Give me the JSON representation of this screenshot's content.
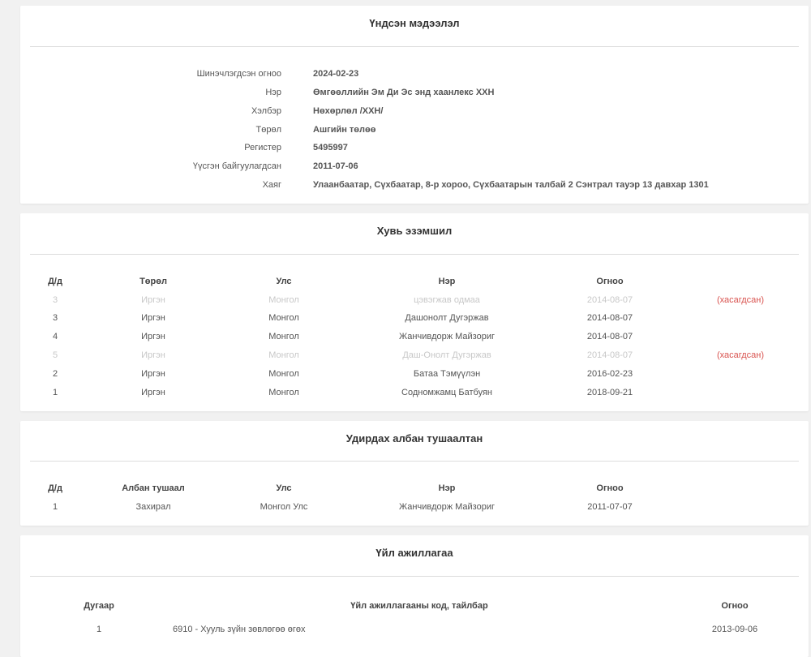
{
  "basic_info": {
    "title": "Үндсэн мэдээлэл",
    "rows": [
      {
        "label": "Шинэчлэгдсэн огноо",
        "value": "2024-02-23"
      },
      {
        "label": "Нэр",
        "value": "Өмгөөллийн Эм Ди Эс энд хаанлекс ХХН"
      },
      {
        "label": "Хэлбэр",
        "value": "Нөхөрлөл /ХХН/"
      },
      {
        "label": "Төрөл",
        "value": "Ашгийн төлөө"
      },
      {
        "label": "Регистер",
        "value": "5495997"
      },
      {
        "label": "Үүсгэн байгуулагдсан",
        "value": "2011-07-06"
      },
      {
        "label": "Хаяг",
        "value": "Улаанбаатар, Сүхбаатар, 8-р хороо, Сүхбаатарын талбай 2 Сэнтрал тауэр 13 давхар 1301"
      }
    ]
  },
  "ownership": {
    "title": "Хувь эзэмшил",
    "headers": [
      "Д/д",
      "Төрөл",
      "Улс",
      "Нэр",
      "Огноо"
    ],
    "rows": [
      {
        "no": "3",
        "type": "Иргэн",
        "country": "Монгол",
        "name": "цэвэгжав одмаа",
        "date": "2014-08-07",
        "status": "(хасагдсан)",
        "deleted": true
      },
      {
        "no": "3",
        "type": "Иргэн",
        "country": "Монгол",
        "name": "Дашонолт Дугэржав",
        "date": "2014-08-07",
        "status": "",
        "deleted": false
      },
      {
        "no": "4",
        "type": "Иргэн",
        "country": "Монгол",
        "name": "Жанчивдорж Майзориг",
        "date": "2014-08-07",
        "status": "",
        "deleted": false
      },
      {
        "no": "5",
        "type": "Иргэн",
        "country": "Монгол",
        "name": "Даш-Онолт Дугэржав",
        "date": "2014-08-07",
        "status": "(хасагдсан)",
        "deleted": true
      },
      {
        "no": "2",
        "type": "Иргэн",
        "country": "Монгол",
        "name": "Батаа Тэмүүлэн",
        "date": "2016-02-23",
        "status": "",
        "deleted": false
      },
      {
        "no": "1",
        "type": "Иргэн",
        "country": "Монгол",
        "name": "Содномжамц Батбуян",
        "date": "2018-09-21",
        "status": "",
        "deleted": false
      }
    ]
  },
  "officials": {
    "title": "Удирдах албан тушаалтан",
    "headers": [
      "Д/д",
      "Албан тушаал",
      "Улс",
      "Нэр",
      "Огноо"
    ],
    "rows": [
      {
        "no": "1",
        "position": "Захирал",
        "country": "Монгол Улс",
        "name": "Жанчивдорж Майзориг",
        "date": "2011-07-07"
      }
    ]
  },
  "activities": {
    "title": "Үйл ажиллагаа",
    "headers": [
      "Дугаар",
      "Үйл ажиллагааны код, тайлбар",
      "Огноо"
    ],
    "rows": [
      {
        "no": "1",
        "desc": "6910 - Хууль зүйн зөвлөгөө өгөх",
        "date": "2013-09-06"
      }
    ]
  },
  "colors": {
    "deleted_text": "#c8c8c8",
    "deleted_tag": "#d9534f"
  }
}
